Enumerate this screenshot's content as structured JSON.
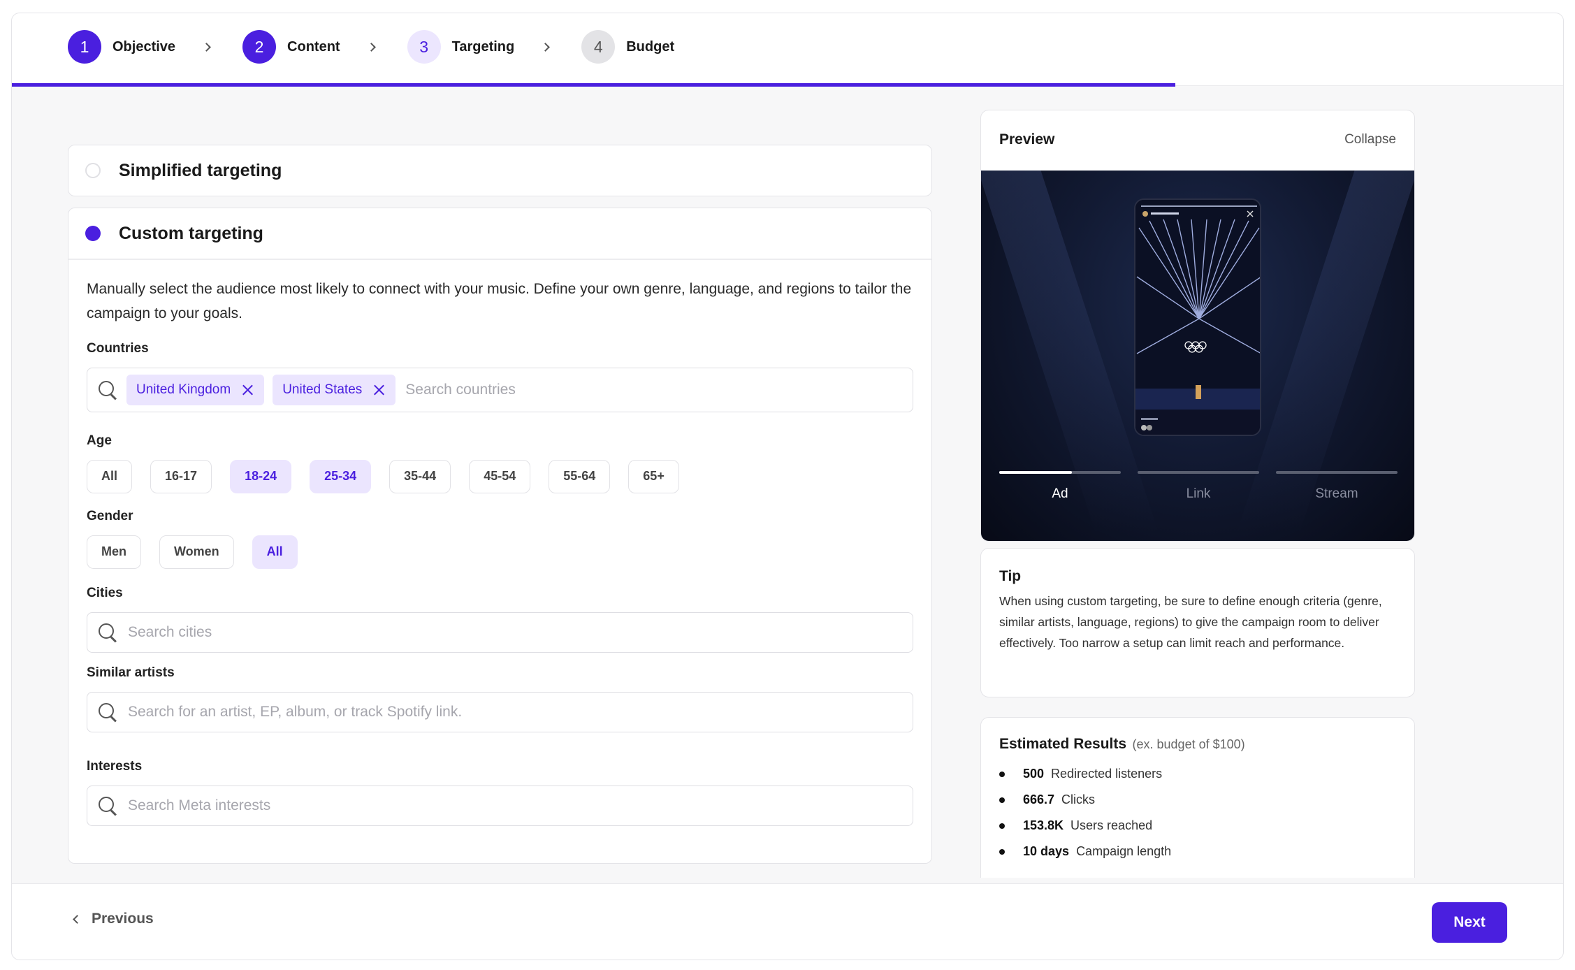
{
  "stepper": {
    "steps": [
      {
        "num": "1",
        "label": "Objective"
      },
      {
        "num": "2",
        "label": "Content"
      },
      {
        "num": "3",
        "label": "Targeting"
      },
      {
        "num": "4",
        "label": "Budget"
      }
    ],
    "progress_percent": 75,
    "accent": "#4a1fdf"
  },
  "simplified": {
    "title": "Simplified targeting",
    "selected": false
  },
  "custom": {
    "title": "Custom targeting",
    "selected": true,
    "description": "Manually select the audience most likely to connect with your music. Define your own genre, language, and regions to tailor the campaign to your goals.",
    "countries": {
      "label": "Countries",
      "selected": [
        "United Kingdom",
        "United States"
      ],
      "placeholder": "Search countries"
    },
    "age": {
      "label": "Age",
      "options": [
        "All",
        "16-17",
        "18-24",
        "25-34",
        "35-44",
        "45-54",
        "55-64",
        "65+"
      ],
      "selected": [
        "18-24",
        "25-34"
      ]
    },
    "gender": {
      "label": "Gender",
      "options": [
        "Men",
        "Women",
        "All"
      ],
      "selected": [
        "All"
      ]
    },
    "cities": {
      "label": "Cities",
      "placeholder": "Search cities"
    },
    "similar_artists": {
      "label": "Similar artists",
      "placeholder": "Search for an artist, EP, album, or track Spotify link."
    },
    "interests": {
      "label": "Interests",
      "placeholder": "Search Meta interests"
    }
  },
  "preview": {
    "title": "Preview",
    "collapse": "Collapse",
    "tabs": [
      "Ad",
      "Link",
      "Stream"
    ],
    "active_tab": 0,
    "active_progress": 0.6
  },
  "tip": {
    "title": "Tip",
    "body": "When using custom targeting, be sure to define enough criteria (genre, similar artists, language, regions) to give the campaign room to deliver effectively. Too narrow a setup can limit reach and performance."
  },
  "results": {
    "title": "Estimated Results",
    "subtitle": "(ex. budget of $100)",
    "items": [
      {
        "value": "500",
        "label": "Redirected listeners"
      },
      {
        "value": "666.7",
        "label": "Clicks"
      },
      {
        "value": "153.8K",
        "label": "Users reached"
      },
      {
        "value": "10 days",
        "label": "Campaign length"
      }
    ]
  },
  "footer": {
    "previous": "Previous",
    "next": "Next"
  }
}
